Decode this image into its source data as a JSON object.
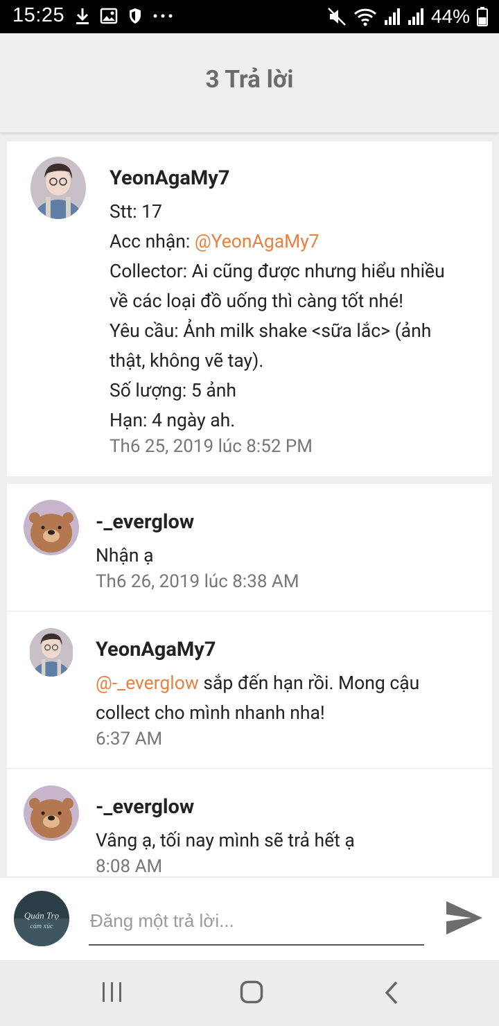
{
  "status_bar": {
    "time": "15:25",
    "battery": "44%"
  },
  "header": {
    "title": "3 Trả lời"
  },
  "original_post": {
    "author": "YeonAgaMy7",
    "lines": [
      "Stt: 17",
      "Collector: Ai cũng được nhưng hiểu nhiều",
      "về các loại đồ uống thì càng tốt nhé!",
      "Yêu cầu: Ảnh milk shake <sữa lắc> (ảnh",
      "thật, không vẽ tay).",
      "Số lượng: 5 ảnh",
      "Hạn: 4 ngày ah."
    ],
    "acc_label": "Acc nhận: ",
    "acc_mention": "@YeonAgaMy7",
    "timestamp": "Th6 25, 2019 lúc 8:52 PM"
  },
  "replies": [
    {
      "author": "-_everglow",
      "text": "Nhận ạ",
      "timestamp": "Th6 26, 2019 lúc 8:38 AM"
    },
    {
      "author": "YeonAgaMy7",
      "mention": "@-_everglow",
      "text_after_mention": " sắp đến hạn rồi. Mong cậu",
      "text_line2": "collect cho mình nhanh nha!",
      "timestamp": "6:37 AM"
    },
    {
      "author": "-_everglow",
      "text": "Vâng ạ, tối nay mình sẽ trả hết ạ",
      "timestamp": "8:08 AM"
    }
  ],
  "reply_input": {
    "placeholder": "Đăng một trả lời...",
    "avatar_text": "Quán Trọ cảm xúc"
  },
  "colors": {
    "mention": "#e8813f",
    "header_title": "#6b6b6b"
  }
}
